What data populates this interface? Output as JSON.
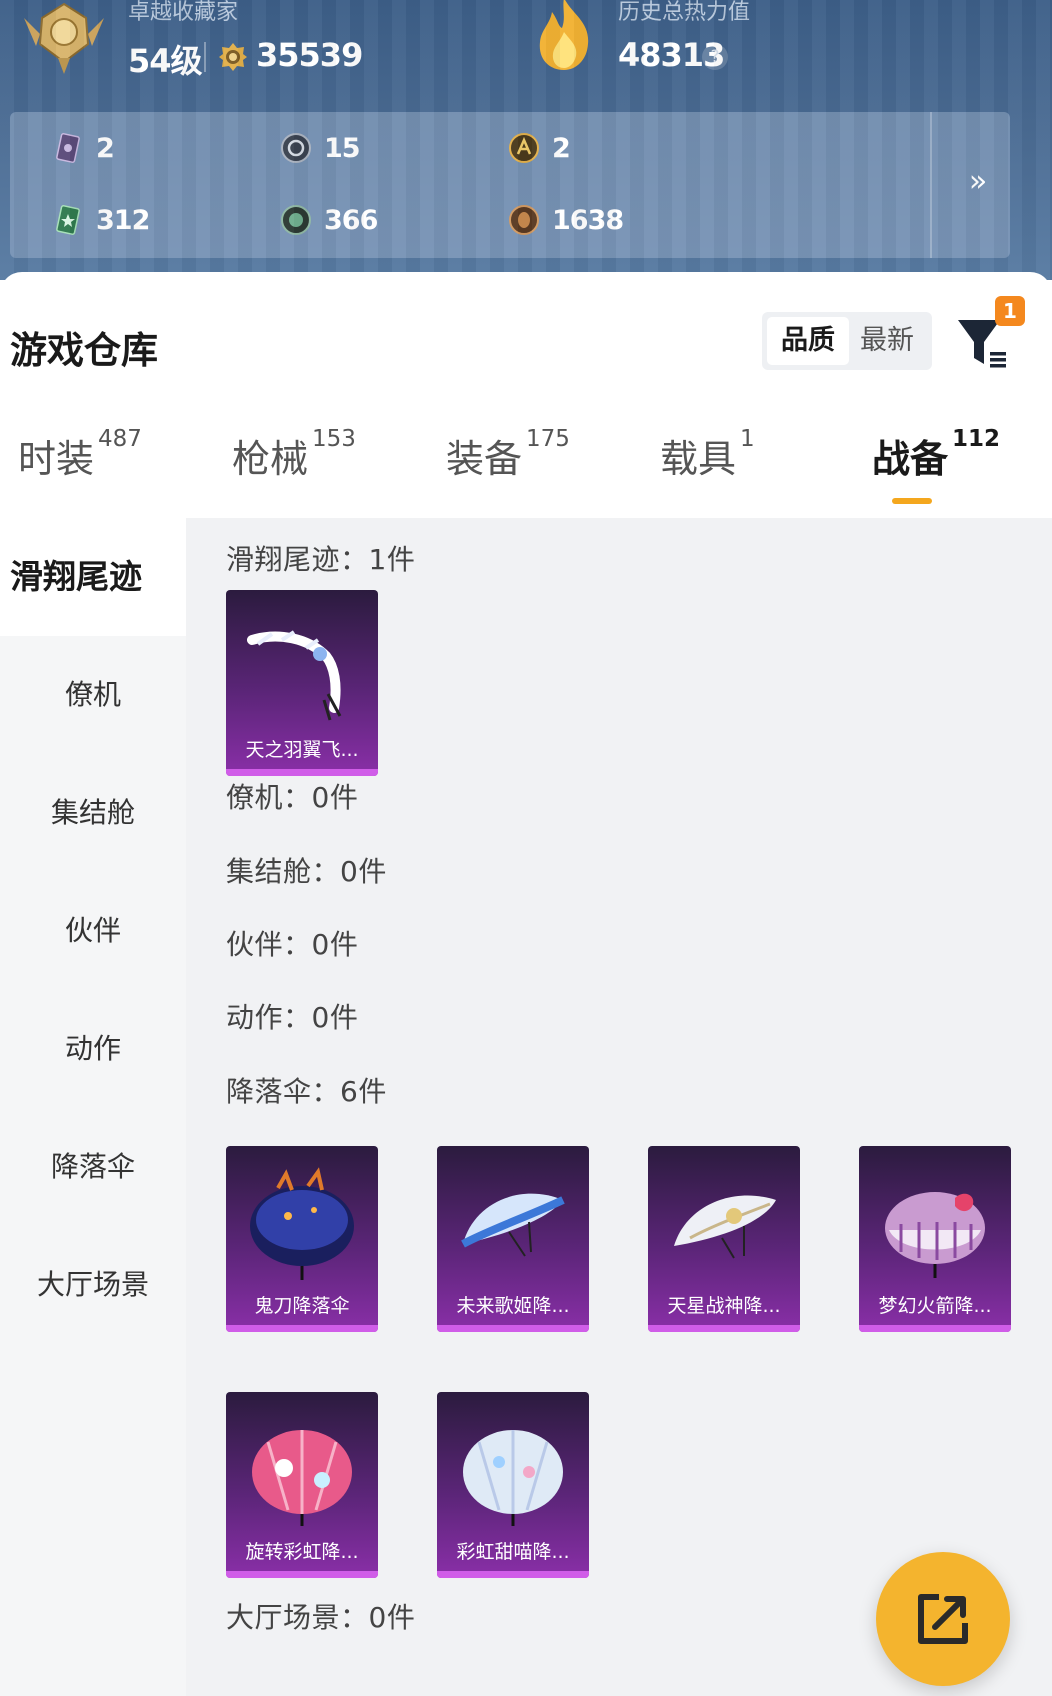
{
  "header": {
    "collector_title": "卓越收藏家",
    "level": "54级",
    "coins": "35539",
    "heat_title": "历史总热力值",
    "heat_value": "48313",
    "help_glyph": "?",
    "colors": {
      "banner": "#4a6b93",
      "gold": "#e2b04a"
    }
  },
  "stats": [
    {
      "icon": "purple-card-icon",
      "value": "2"
    },
    {
      "icon": "silver-coin-icon",
      "value": "15"
    },
    {
      "icon": "gold-emblem-icon",
      "value": "2"
    },
    {
      "icon": "green-card-icon",
      "value": "312"
    },
    {
      "icon": "green-orb-icon",
      "value": "366"
    },
    {
      "icon": "bronze-orb-icon",
      "value": "1638"
    }
  ],
  "stats_expand_glyph": "»",
  "warehouse": {
    "title": "游戏仓库",
    "sort_options": [
      "品质",
      "最新"
    ],
    "filter_badge": "1"
  },
  "tabs": [
    {
      "label": "时装",
      "count": "487"
    },
    {
      "label": "枪械",
      "count": "153"
    },
    {
      "label": "装备",
      "count": "175"
    },
    {
      "label": "载具",
      "count": "1"
    },
    {
      "label": "战备",
      "count": "112",
      "active": true
    }
  ],
  "categories": [
    "滑翔尾迹",
    "僚机",
    "集结舱",
    "伙伴",
    "动作",
    "降落伞",
    "大厅场景"
  ],
  "sections": {
    "glide_trail": {
      "title": "滑翔尾迹：1件",
      "items": [
        "天之羽翼飞..."
      ]
    },
    "wingman": {
      "title": "僚机：0件"
    },
    "capsule": {
      "title": "集结舱：0件"
    },
    "partner": {
      "title": "伙伴：0件"
    },
    "emote": {
      "title": "动作：0件"
    },
    "parachute": {
      "title": "降落伞：6件",
      "items": [
        "鬼刀降落伞",
        "未来歌姬降...",
        "天星战神降...",
        "梦幻火箭降...",
        "旋转彩虹降...",
        "彩虹甜喵降..."
      ]
    },
    "lobby": {
      "title": "大厅场景：0件"
    }
  },
  "accent_colors": {
    "tab_underline": "#f4a71e",
    "card_purple": "#8a2fa8",
    "share_button": "#f4b42e",
    "badge": "#f4881e"
  }
}
